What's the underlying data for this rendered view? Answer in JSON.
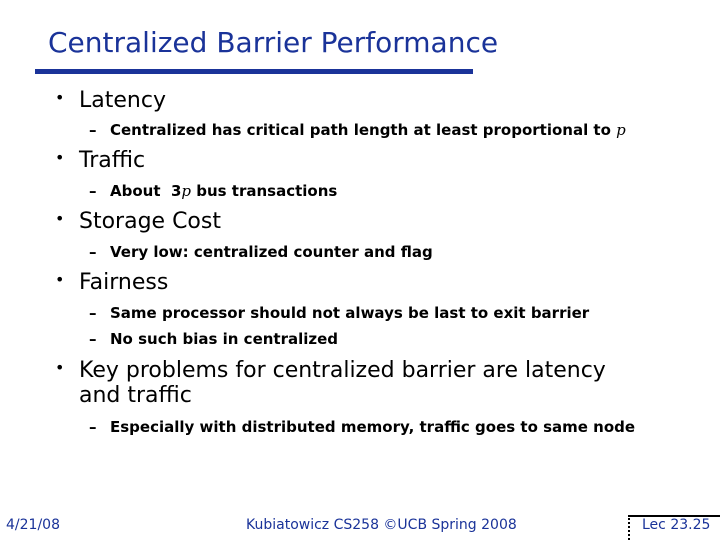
{
  "slide": {
    "title": "Centralized Barrier Performance",
    "colors": {
      "title": "#1a3399",
      "rule": "#1a3399",
      "footer": "#1a3399",
      "body": "#000000"
    },
    "bullets": [
      {
        "text": "Latency",
        "sub": [
          {
            "text": "Centralized has critical path length at least proportional to ",
            "var": "p"
          }
        ]
      },
      {
        "text": "Traffic",
        "sub": [
          {
            "prefix": "About  3",
            "var": "p",
            "text": " bus transactions"
          }
        ]
      },
      {
        "text": "Storage Cost",
        "sub": [
          {
            "text": "Very low: centralized counter and flag"
          }
        ]
      },
      {
        "text": "Fairness",
        "sub": [
          {
            "text": "Same processor should not always be last to exit barrier"
          },
          {
            "text": "No such bias in centralized"
          }
        ]
      },
      {
        "text_line1": "Key problems for centralized barrier are latency",
        "text_line2": "and traffic",
        "sub": [
          {
            "text": "Especially with distributed memory, traffic goes to same node"
          }
        ]
      }
    ],
    "bullet_glyph": "•",
    "sub_glyph": "–"
  },
  "footer": {
    "date": "4/21/08",
    "course": "Kubiatowicz CS258 ©UCB Spring 2008",
    "slide_number": "Lec 23.25"
  }
}
